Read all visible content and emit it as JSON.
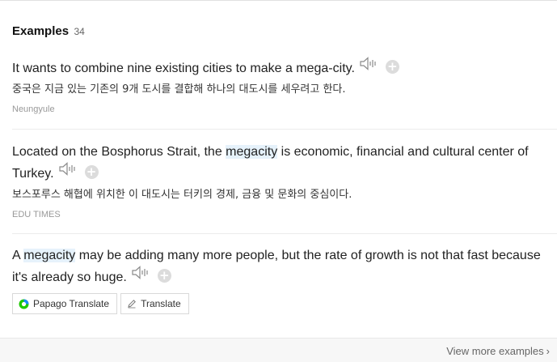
{
  "examples_header": {
    "title": "Examples",
    "count": "34"
  },
  "examples": [
    {
      "sentence": "It wants to combine nine existing cities to make a mega-city.",
      "translation": "중국은 지금 있는 기존의 9개 도시를 결합해 하나의 대도시를 세우려고 한다.",
      "source": "Neungyule"
    },
    {
      "sentence_before": "Located on the Bosphorus Strait, the ",
      "highlight": "megacity",
      "sentence_after": " is economic, financial and cultural center of Turkey.",
      "translation": "보스포루스 해협에 위치한 이 대도시는 터키의 경제, 금융 및 문화의 중심이다.",
      "source": "EDU TIMES"
    },
    {
      "sentence_before": "A ",
      "highlight": "megacity",
      "sentence_after": " may be adding many more people, but the rate of growth is not that fast because it's already so huge."
    }
  ],
  "buttons": {
    "papago_translate": "Papago Translate",
    "translate": "Translate"
  },
  "footer": {
    "view_more": "View more examples"
  },
  "icons": {
    "speaker": "speaker-icon",
    "add": "plus-circle-icon",
    "papago": "papago-logo-icon",
    "translate": "pencil-icon",
    "chevron": "chevron-right-icon"
  },
  "colors": {
    "highlight": "#e6f2fb",
    "papago_green": "#1ec800",
    "papago_blue": "#1b8cf5"
  }
}
